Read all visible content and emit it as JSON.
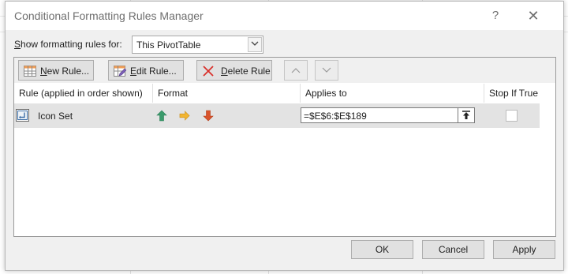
{
  "dialog": {
    "title": "Conditional Formatting Rules Manager",
    "help_glyph": "?",
    "close_glyph": "✕"
  },
  "scope": {
    "label_prefix": "S",
    "label_rest": "how formatting rules for:",
    "selected": "This PivotTable"
  },
  "toolbar": {
    "new_rule": {
      "u": "N",
      "rest": "ew Rule..."
    },
    "edit_rule": {
      "u": "E",
      "rest": "dit Rule..."
    },
    "delete_rule": {
      "u": "D",
      "rest": "elete Rule"
    }
  },
  "table": {
    "columns": [
      "Rule (applied in order shown)",
      "Format",
      "Applies to",
      "Stop If True"
    ],
    "rows": [
      {
        "rule": "Icon Set",
        "format_icons": [
          "green-up-arrow-icon",
          "yellow-right-arrow-icon",
          "red-down-arrow-icon"
        ],
        "applies_to": "=$E$6:$E$189",
        "stop_if_true": false
      }
    ]
  },
  "buttons": {
    "ok": "OK",
    "cancel": "Cancel",
    "apply": "Apply"
  },
  "colors": {
    "arrow_up": "#3a9a6b",
    "arrow_right": "#f2b531",
    "arrow_down": "#d9532b",
    "selected_row": "#e3e3e3"
  }
}
